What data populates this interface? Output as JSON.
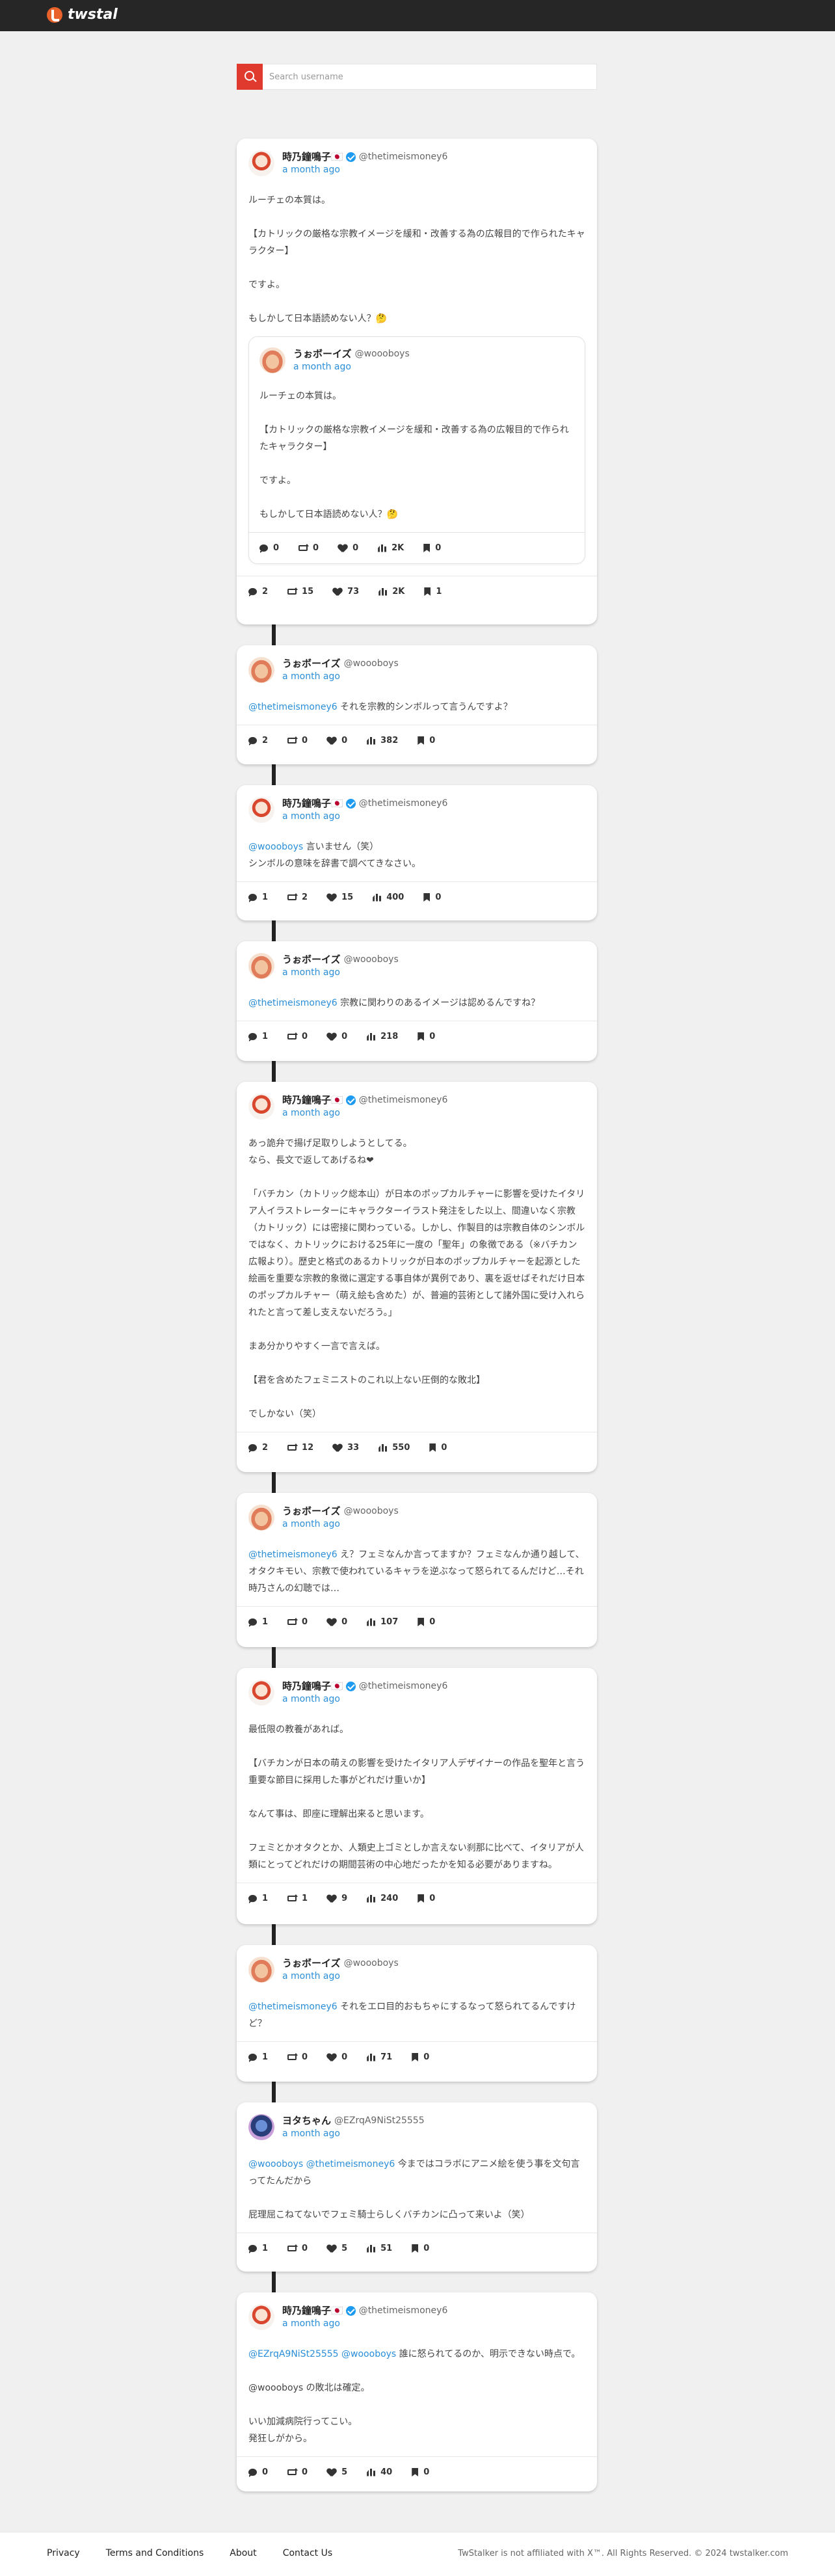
{
  "header": {
    "logo_text": "twstal"
  },
  "search": {
    "placeholder": "Search username"
  },
  "main_tweet": {
    "name": "時乃鐘鳴子🇯🇵",
    "handle": "@thetimeismoney6",
    "time": "a month ago",
    "text": "ルーチェの本質は。\n\n【カトリックの厳格な宗教イメージを緩和・改善する為の広報目的で作られたキャラクター】\n\nですよ。\n\nもしかして日本語読めない人？🤔",
    "quote": {
      "name": "うぉボーイズ",
      "handle": "@woooboys",
      "time": "a month ago",
      "text": "ルーチェの本質は。\n\n【カトリックの厳格な宗教イメージを緩和・改善する為の広報目的で作られたキャラクター】\n\nですよ。\n\nもしかして日本語読めない人？🤔",
      "stats": {
        "replies": "0",
        "retweets": "0",
        "likes": "0",
        "views": "2K",
        "bookmarks": "0"
      }
    },
    "stats": {
      "replies": "2",
      "retweets": "15",
      "likes": "73",
      "views": "2K",
      "bookmarks": "1"
    }
  },
  "replies": [
    {
      "name": "うぉボーイズ",
      "handle": "@woooboys",
      "time": "a month ago",
      "mention": "@thetimeismoney6",
      "text": " それを宗教的シンボルって言うんですよ？",
      "stats": {
        "replies": "2",
        "retweets": "0",
        "likes": "0",
        "views": "382",
        "bookmarks": "0"
      }
    },
    {
      "name": "時乃鐘鳴子🇯🇵",
      "handle": "@thetimeismoney6",
      "time": "a month ago",
      "mention": "@woooboys",
      "text": " 言いません（笑）\nシンボルの意味を辞書で調べてきなさい。",
      "stats": {
        "replies": "1",
        "retweets": "2",
        "likes": "15",
        "views": "400",
        "bookmarks": "0"
      }
    },
    {
      "name": "うぉボーイズ",
      "handle": "@woooboys",
      "time": "a month ago",
      "mention": "@thetimeismoney6",
      "text": " 宗教に関わりのあるイメージは認めるんですね？",
      "stats": {
        "replies": "1",
        "retweets": "0",
        "likes": "0",
        "views": "218",
        "bookmarks": "0"
      }
    },
    {
      "name": "時乃鐘鳴子🇯🇵",
      "handle": "@thetimeismoney6",
      "time": "a month ago",
      "mention": "",
      "text": "あっ詭弁で揚げ足取りしようとしてる。\nなら、長文で返してあげるね❤\n\n「バチカン（カトリック総本山）が日本のポップカルチャーに影響を受けたイタリア人イラストレーターにキャラクターイラスト発注をした以上、間違いなく宗教（カトリック）には密接に関わっている。しかし、作製目的は宗教自体のシンボルではなく、カトリックにおける25年に一度の「聖年」の象徴である（※バチカン広報より）。歴史と格式のあるカトリックが日本のポップカルチャーを起源とした絵画を重要な宗教的象徴に選定する事自体が異例であり、裏を返せばそれだけ日本のポップカルチャー（萌え絵も含めた）が、普遍的芸術として諸外国に受け入れられたと言って差し支えないだろう。」\n\nまあ分かりやすく一言で言えば。\n\n【君を含めたフェミニストのこれ以上ない圧倒的な敗北】\n\nでしかない（笑）",
      "stats": {
        "replies": "2",
        "retweets": "12",
        "likes": "33",
        "views": "550",
        "bookmarks": "0"
      }
    },
    {
      "name": "うぉボーイズ",
      "handle": "@woooboys",
      "time": "a month ago",
      "mention": "@thetimeismoney6",
      "text": " え？フェミなんか言ってますか？フェミなんか通り越して、オタクキモい、宗教で使われているキャラを逆ぶなって怒られてるんだけど…それ時乃さんの幻聴では…",
      "stats": {
        "replies": "1",
        "retweets": "0",
        "likes": "0",
        "views": "107",
        "bookmarks": "0"
      }
    },
    {
      "name": "時乃鐘鳴子🇯🇵",
      "handle": "@thetimeismoney6",
      "time": "a month ago",
      "mention": "",
      "text": "最低限の教養があれば。\n\n【バチカンが日本の萌えの影響を受けたイタリア人デザイナーの作品を聖年と言う重要な節目に採用した事がどれだけ重いか】\n\nなんて事は、即座に理解出来ると思います。\n\nフェミとかオタクとか、人類史上ゴミとしか言えない刹那に比べて、イタリアが人類にとってどれだけの期間芸術の中心地だったかを知る必要がありますね。",
      "stats": {
        "replies": "1",
        "retweets": "1",
        "likes": "9",
        "views": "240",
        "bookmarks": "0"
      }
    },
    {
      "name": "うぉボーイズ",
      "handle": "@woooboys",
      "time": "a month ago",
      "mention": "@thetimeismoney6",
      "text": " それをエロ目的おもちゃにするなって怒られてるんですけど？",
      "stats": {
        "replies": "1",
        "retweets": "0",
        "likes": "0",
        "views": "71",
        "bookmarks": "0"
      }
    },
    {
      "name": "ヨタちゃん",
      "handle": "@EZrqA9NiSt25555",
      "time": "a month ago",
      "mention": "@woooboys @thetimeismoney6",
      "text": " 今まではコラボにアニメ絵を使う事を文句言ってたんだから\n\n屁理屈こねてないでフェミ騎士らしくバチカンに凸って来いよ（笑）",
      "stats": {
        "replies": "1",
        "retweets": "0",
        "likes": "5",
        "views": "51",
        "bookmarks": "0"
      }
    },
    {
      "name": "時乃鐘鳴子🇯🇵",
      "handle": "@thetimeismoney6",
      "time": "a month ago",
      "mention": "@EZrqA9NiSt25555 @woooboys",
      "text": " 誰に怒られてるのか、明示できない時点で。\n\n@woooboys の敗北は確定。\n\nいい加減病院行ってこい。\n発狂しがから。",
      "stats": {
        "replies": "0",
        "retweets": "0",
        "likes": "5",
        "views": "40",
        "bookmarks": "0"
      }
    }
  ],
  "footer": {
    "links": [
      "Privacy",
      "Terms and Conditions",
      "About",
      "Contact Us"
    ],
    "note": "TwStalker is not affiliated with X™. All Rights Reserved. © 2024 twstalker.com"
  }
}
